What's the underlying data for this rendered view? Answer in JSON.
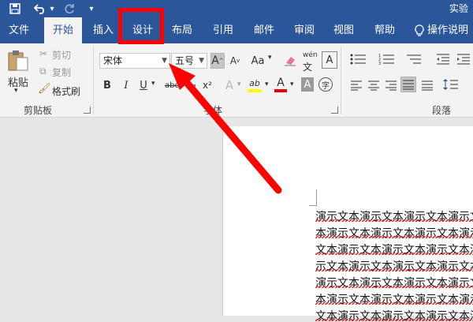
{
  "window": {
    "title": "实验",
    "accent": "#2b579a"
  },
  "quick_access": {
    "save_icon": "save-icon",
    "undo_icon": "undo-icon",
    "undo_dropdown": "▾",
    "redo_icon": "redo-icon",
    "customize": "▾"
  },
  "tabs": [
    {
      "label": "文件"
    },
    {
      "label": "开始",
      "active": true
    },
    {
      "label": "插入"
    },
    {
      "label": "设计"
    },
    {
      "label": "布局"
    },
    {
      "label": "引用"
    },
    {
      "label": "邮件"
    },
    {
      "label": "审阅"
    },
    {
      "label": "视图"
    },
    {
      "label": "帮助"
    }
  ],
  "tell_me": {
    "icon": "lightbulb-icon",
    "label": "操作说明"
  },
  "clipboard": {
    "paste_label": "粘贴",
    "cut_label": "剪切",
    "copy_label": "复制",
    "format_painter_label": "格式刷",
    "group_label": "剪贴板"
  },
  "font": {
    "font_name": "宋体",
    "font_size": "五号",
    "grow_label": "A",
    "shrink_label": "A",
    "change_case_label": "Aa",
    "phonetic_label": "wén",
    "bold_label": "B",
    "italic_label": "I",
    "underline_label": "U",
    "strikethrough_label": "abc",
    "subscript_label": "x₂",
    "superscript_label": "x²",
    "text_effects_label": "A",
    "highlight_label": "ab",
    "font_color_label": "A",
    "char_shading_label": "A",
    "enclose_label": "字",
    "group_label": "字体"
  },
  "paragraph": {
    "group_label": "段落"
  },
  "document": {
    "lines": [
      "演示文本演示文本演示文本演示文本",
      "本演示文本演示文本演示文本演示文本",
      "文本演示文本演示文本演示文本演示文本",
      "示文本演示文本演示文本演示文本演示",
      "演示文本演示文本演示文本演示文本",
      "本演示文本演示文本演示文本演示文本",
      "文本演示文本演示文本演示文本演示文本"
    ]
  },
  "annotation_color": "#ff0000"
}
